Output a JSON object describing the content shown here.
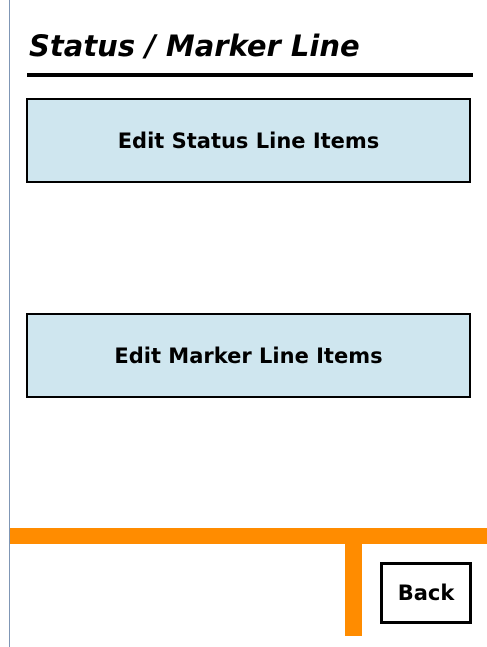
{
  "screen": {
    "title": "Status / Marker Line"
  },
  "menu": {
    "edit_status_label": "Edit Status Line Items",
    "edit_marker_label": "Edit Marker Line Items"
  },
  "footer": {
    "back_label": "Back"
  },
  "colors": {
    "button_background": "#cfe6ef",
    "accent_bar": "#ff8c00",
    "title_text": "#000000"
  }
}
